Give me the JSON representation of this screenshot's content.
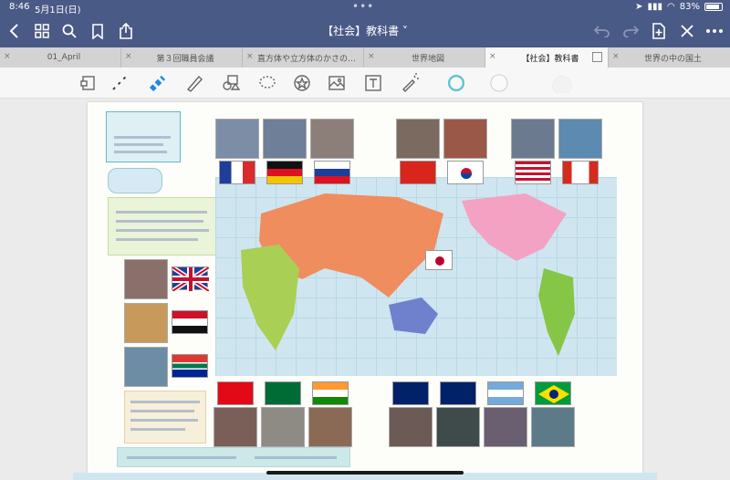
{
  "status": {
    "time": "8:46",
    "date": "5月1日(日)",
    "battery": "83%",
    "dots": "•••"
  },
  "nav": {
    "title": "【社会】教科書 ˅"
  },
  "tabs": [
    {
      "label": "01_April",
      "active": false
    },
    {
      "label": "第３回職員会議",
      "active": false
    },
    {
      "label": "直方体や立方体のかさの…",
      "active": false
    },
    {
      "label": "世界地図",
      "active": false
    },
    {
      "label": "【社会】教科書",
      "active": true
    },
    {
      "label": "世界の中の国土",
      "active": false
    }
  ],
  "tab_close": "×",
  "icons": {
    "back": "chevron-left-icon",
    "grid": "grid-icon",
    "search": "search-icon",
    "bookmark": "bookmark-icon",
    "share": "share-icon",
    "undo": "undo-icon",
    "redo": "redo-icon",
    "new_page": "new-page-icon",
    "close": "close-icon",
    "more": "more-icon"
  },
  "colors": {
    "nav_bg": "#4a5a86",
    "tool_highlighter": "#1e88e5",
    "pen_ring": "#5cc3d6",
    "continent_eurasia": "#ef8d5e",
    "continent_africa": "#a9cf55",
    "continent_americas_n": "#f3a2c3",
    "continent_americas_s": "#86c646",
    "continent_oceania": "#6f80cc"
  }
}
